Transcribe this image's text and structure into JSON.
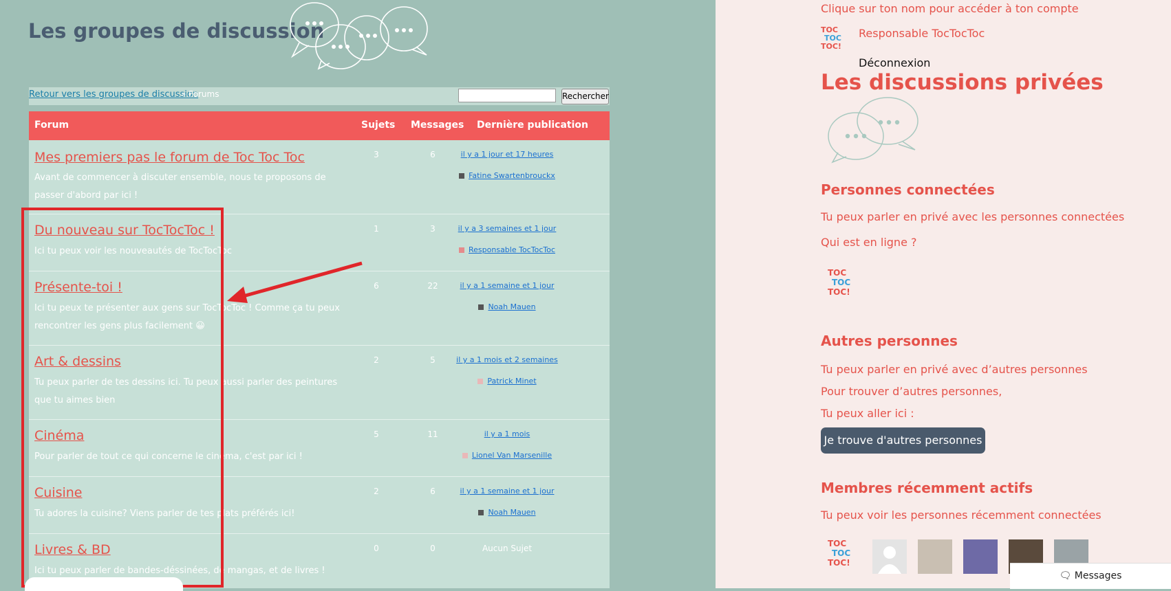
{
  "left": {
    "title": "Les groupes de discussion",
    "breadcrumb": {
      "link": "Retour vers les groupes de discussion",
      "current": "» Forums"
    },
    "search": {
      "placeholder": "",
      "button": "Rechercher"
    },
    "table": {
      "headers": {
        "forum": "Forum",
        "topics": "Sujets",
        "messages": "Messages",
        "last": "Dernière publication"
      },
      "rows": [
        {
          "title": "Mes premiers pas le forum de Toc Toc Toc",
          "desc": "Avant de commencer à discuter ensemble, nous te proposons de passer d'abord par ici !",
          "topics": "3",
          "messages": "6",
          "last": "il y a 1 jour et 17 heures",
          "author": "Fatine Swartenbrouckx"
        },
        {
          "title": "Du nouveau sur TocTocToc !",
          "desc": "Ici tu peux voir les nouveautés de TocTocToc",
          "topics": "1",
          "messages": "3",
          "last": "il y a 3 semaines et 1 jour",
          "author": "Responsable TocTocToc"
        },
        {
          "title": "Présente-toi !",
          "desc": "Ici tu peux te présenter aux gens sur TocTocToc ! Comme ça tu peux rencontrer les gens plus facilement 😀",
          "topics": "6",
          "messages": "22",
          "last": "il y a 1 semaine et 1 jour",
          "author": "Noah Mauen"
        },
        {
          "title": "Art & dessins",
          "desc": "Tu peux parler de tes dessins ici. Tu peux aussi parler des peintures que tu aimes bien",
          "topics": "2",
          "messages": "5",
          "last": "il y a 1 mois et 2 semaines",
          "author": "Patrick Minet"
        },
        {
          "title": "Cinéma",
          "desc": "Pour parler de tout ce qui concerne le cinéma, c'est par ici !",
          "topics": "5",
          "messages": "11",
          "last": "il y a 1 mois",
          "author": "Lionel Van Marsenille"
        },
        {
          "title": "Cuisine",
          "desc": "Tu adores la cuisine? Viens parler de tes plats préférés ici!",
          "topics": "2",
          "messages": "6",
          "last": "il y a 1 semaine et 1 jour",
          "author": "Noah Mauen"
        },
        {
          "title": "Livres & BD",
          "desc": "Ici tu peux parler de bandes-déssinées, de mangas, et de livres !",
          "topics": "0",
          "messages": "0",
          "last": "Aucun Sujet",
          "author": ""
        }
      ]
    }
  },
  "right": {
    "account_hint": "Clique sur ton nom pour accéder à ton compte",
    "user_name": "Responsable TocTocToc",
    "logout": "Déconnexion",
    "private_title": "Les discussions privées",
    "connected_title": "Personnes connectées",
    "connected_text": "Tu peux parler en privé avec les personnes connectées",
    "who_online": "Qui est en ligne ?",
    "others_title": "Autres personnes",
    "others_text1": "Tu peux parler en privé avec d’autres personnes",
    "others_text2": "Pour trouver d’autres personnes,",
    "others_text3": "Tu peux aller ici :",
    "find_button": "Je trouve d'autres personnes",
    "recent_title": "Membres récemment actifs",
    "recent_text": "Tu peux voir les personnes récemment connectées",
    "messages_button": "Messages"
  },
  "logo_text": [
    "TOC",
    "TOC",
    "TOC!"
  ],
  "colors": {
    "accent": "#e5534b",
    "header_red": "#f15a5a",
    "left_bg": "#9fbfb6",
    "right_bg": "#f8ecea",
    "highlight": "#e0262a"
  }
}
